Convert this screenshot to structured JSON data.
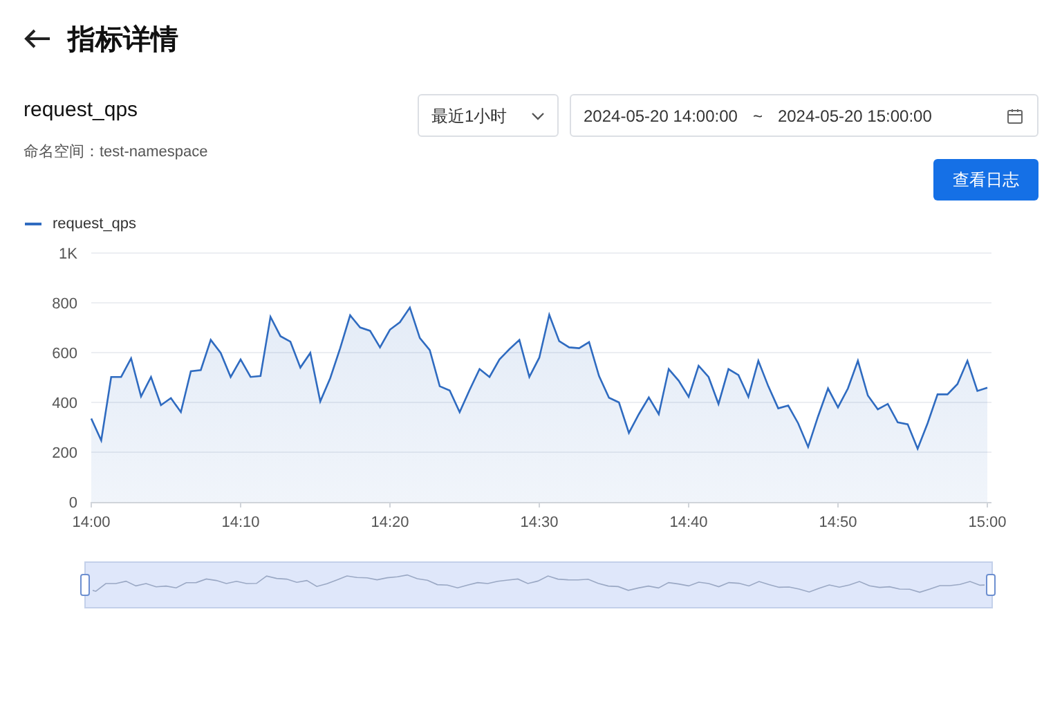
{
  "header": {
    "title": "指标详情"
  },
  "metric": {
    "name": "request_qps",
    "namespace_label": "命名空间：",
    "namespace": "test-namespace"
  },
  "range_select": {
    "value": "最近1小时"
  },
  "date_range": {
    "start": "2024-05-20 14:00:00",
    "separator": "~",
    "end": "2024-05-20 15:00:00"
  },
  "logs_button": "查看日志",
  "chart": {
    "range_slider": {
      "handles": [
        {
          "level": 0
        },
        {
          "level": 1
        }
      ]
    },
    "chart_data": {
      "type": "area",
      "grid": true,
      "ylim": [
        0,
        1000
      ],
      "yticks": [
        0,
        200,
        400,
        600,
        800,
        {
          "value": 1000,
          "label": "1K"
        }
      ],
      "categories": [
        "14:00",
        null,
        null,
        null,
        null,
        null,
        null,
        null,
        null,
        null,
        null,
        null,
        null,
        null,
        null,
        "14:10",
        null,
        null,
        null,
        null,
        null,
        null,
        null,
        null,
        null,
        null,
        null,
        null,
        null,
        null,
        "14:20",
        null,
        null,
        null,
        null,
        null,
        null,
        null,
        null,
        null,
        null,
        null,
        null,
        null,
        null,
        "14:30",
        null,
        null,
        null,
        null,
        null,
        null,
        null,
        null,
        null,
        null,
        null,
        null,
        null,
        null,
        "14:40",
        null,
        null,
        null,
        null,
        null,
        null,
        null,
        null,
        null,
        null,
        null,
        null,
        null,
        null,
        "14:50",
        null,
        null,
        null,
        null,
        null,
        null,
        null,
        null,
        null,
        null,
        null,
        null,
        null,
        null,
        "15:00"
      ],
      "series": [
        {
          "name": "request_qps",
          "color": "#2f6bc0",
          "values": [
            335,
            247,
            502,
            502,
            577,
            424,
            502,
            389,
            417,
            361,
            525,
            530,
            651,
            599,
            502,
            573,
            502,
            506,
            744,
            666,
            644,
            540,
            599,
            404,
            497,
            618,
            750,
            701,
            688,
            621,
            692,
            722,
            781,
            659,
            610,
            465,
            448,
            361,
            450,
            534,
            502,
            573,
            614,
            651,
            502,
            580,
            752,
            646,
            621,
            618,
            642,
            506,
            419,
            400,
            277,
            353,
            420,
            353,
            534,
            487,
            422,
            547,
            502,
            394,
            534,
            510,
            422,
            567,
            465,
            376,
            387,
            316,
            221,
            344,
            456,
            380,
            456,
            567,
            428,
            372,
            394,
            320,
            312,
            214,
            316,
            432,
            432,
            474,
            567,
            446,
            459
          ]
        }
      ]
    }
  }
}
